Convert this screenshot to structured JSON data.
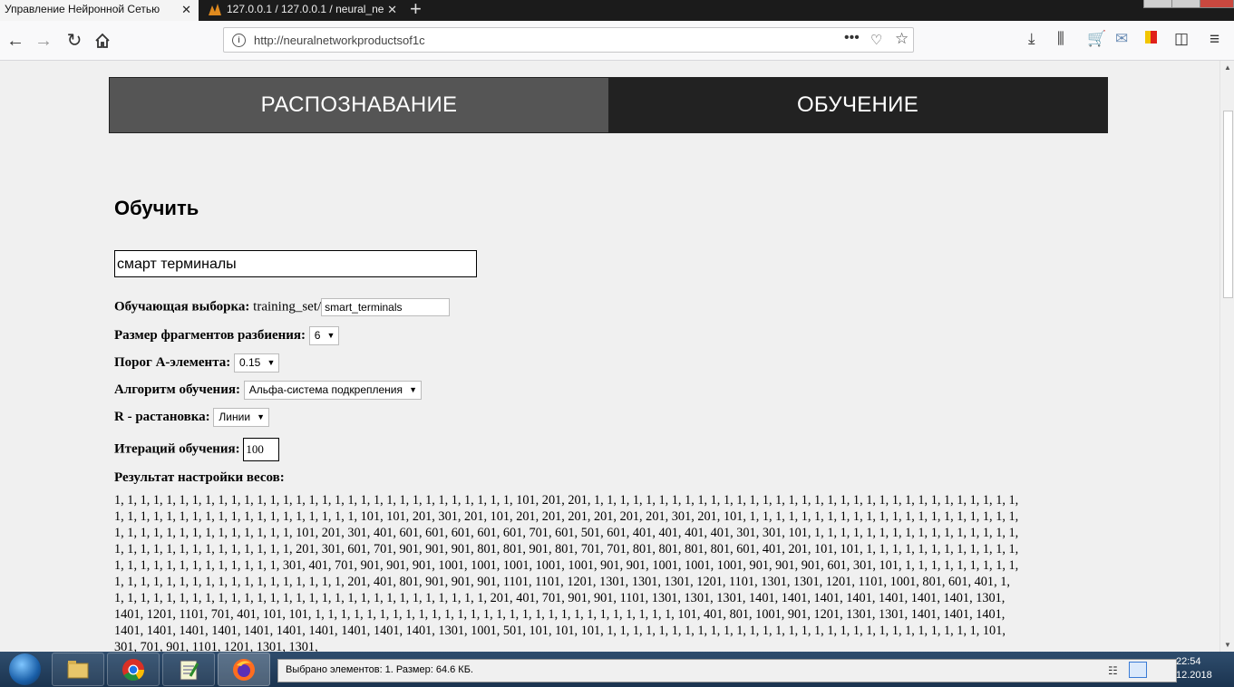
{
  "browser": {
    "tabs": [
      {
        "title": "Управление Нейронной Сетью",
        "active": true
      },
      {
        "title": "127.0.0.1 / 127.0.0.1 / neural_ne",
        "active": false
      }
    ],
    "url": "http://neuralnetworkproductsof1c"
  },
  "menu": {
    "recognition": "РАСПОЗНАВАНИЕ",
    "training": "ОБУЧЕНИЕ"
  },
  "form": {
    "heading": "Обучить",
    "name_value": "смарт терминалы",
    "training_set_label": "Обучающая выборка:",
    "training_set_prefix": "training_set/",
    "training_set_value": "smart_terminals",
    "fragment_size_label": "Размер фрагментов разбиения:",
    "fragment_size_value": "6",
    "threshold_label": "Порог А-элемента:",
    "threshold_value": "0.15",
    "algorithm_label": "Алгоритм обучения:",
    "algorithm_value": "Альфа-система подкрепления",
    "r_label": "R - растановка:",
    "r_value": "Линии",
    "iterations_label": "Итераций обучения:",
    "iterations_value": "100",
    "result_label": "Результат настройки весов:",
    "result_text": "1, 1, 1, 1, 1, 1, 1, 1, 1, 1, 1, 1, 1, 1, 1, 1, 1, 1, 1, 1, 1, 1, 1, 1, 1, 1, 1, 1, 1, 1, 1, 101, 201, 201, 1, 1, 1, 1, 1, 1, 1, 1, 1, 1, 1, 1, 1, 1, 1, 1, 1, 1, 1, 1, 1, 1, 1, 1, 1, 1, 1, 1, 1, 1, 1, 1, 1, 1, 1, 1, 1, 1, 1, 1, 1, 1, 1, 1, 1, 1, 1, 1, 1, 1, 1, 1, 101, 101, 201, 301, 201, 101, 201, 201, 201, 201, 201, 201, 301, 201, 101, 1, 1, 1, 1, 1, 1, 1, 1, 1, 1, 1, 1, 1, 1, 1, 1, 1, 1, 1, 1, 1, 1, 1, 1, 1, 1, 1, 1, 1, 1, 1, 1, 1, 1, 1, 101, 201, 301, 401, 601, 601, 601, 601, 601, 701, 601, 501, 601, 401, 401, 401, 401, 301, 301, 101, 1, 1, 1, 1, 1, 1, 1, 1, 1, 1, 1, 1, 1, 1, 1, 1, 1, 1, 1, 1, 1, 1, 1, 1, 1, 1, 1, 1, 1, 1, 201, 301, 601, 701, 901, 901, 901, 801, 801, 901, 801, 701, 701, 801, 801, 801, 801, 601, 401, 201, 101, 101, 1, 1, 1, 1, 1, 1, 1, 1, 1, 1, 1, 1, 1, 1, 1, 1, 1, 1, 1, 1, 1, 1, 1, 1, 1, 301, 401, 701, 901, 901, 901, 1001, 1001, 1001, 1001, 1001, 901, 901, 1001, 1001, 1001, 901, 901, 901, 601, 301, 101, 1, 1, 1, 1, 1, 1, 1, 1, 1, 1, 1, 1, 1, 1, 1, 1, 1, 1, 1, 1, 1, 1, 1, 1, 1, 1, 1, 201, 401, 801, 901, 901, 901, 1101, 1101, 1201, 1301, 1301, 1301, 1201, 1101, 1301, 1301, 1201, 1101, 1001, 801, 601, 401, 1, 1, 1, 1, 1, 1, 1, 1, 1, 1, 1, 1, 1, 1, 1, 1, 1, 1, 1, 1, 1, 1, 1, 1, 1, 1, 1, 1, 1, 1, 201, 401, 701, 901, 901, 1101, 1301, 1301, 1301, 1401, 1401, 1401, 1401, 1401, 1401, 1401, 1301, 1401, 1201, 1101, 701, 401, 101, 101, 1, 1, 1, 1, 1, 1, 1, 1, 1, 1, 1, 1, 1, 1, 1, 1, 1, 1, 1, 1, 1, 1, 1, 1, 1, 1, 1, 1, 101, 401, 801, 1001, 901, 1201, 1301, 1301, 1401, 1401, 1401, 1401, 1401, 1401, 1401, 1401, 1401, 1401, 1401, 1401, 1401, 1301, 1001, 501, 101, 101, 101, 1, 1, 1, 1, 1, 1, 1, 1, 1, 1, 1, 1, 1, 1, 1, 1, 1, 1, 1, 1, 1, 1, 1, 1, 1, 1, 1, 1, 1, 101, 301, 701, 901, 1101, 1201, 1301, 1301,"
  },
  "taskbar": {
    "status_text": "Выбрано элементов: 1. Размер: 64.6 КБ.",
    "time": "22:54",
    "date": "12.2018"
  }
}
